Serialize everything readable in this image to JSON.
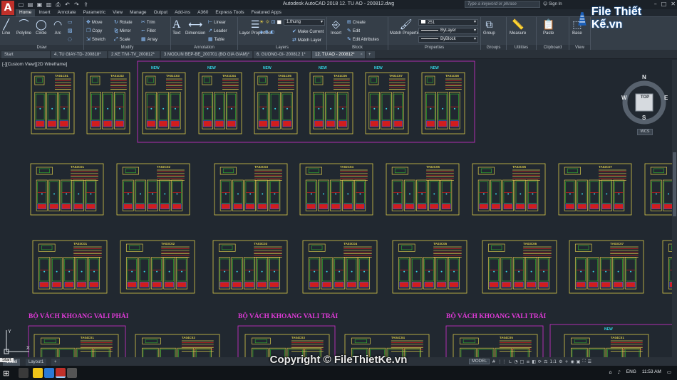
{
  "app": {
    "logo": "A",
    "title": "Autodesk AutoCAD 2018    12. TU AO - 200812.dwg",
    "search_placeholder": "Type a keyword or phrase",
    "signin": "Sign In"
  },
  "ribbon_tabs": [
    "Home",
    "Insert",
    "Annotate",
    "Parametric",
    "View",
    "Manage",
    "Output",
    "Add-ins",
    "A360",
    "Express Tools",
    "Featured Apps"
  ],
  "panels": {
    "draw": {
      "label": "Draw",
      "tools": [
        "Line",
        "Polyline",
        "Circle",
        "Arc"
      ]
    },
    "modify": {
      "label": "Modify",
      "tools": [
        "Move",
        "Rotate",
        "Trim",
        "Copy",
        "Mirror",
        "Fillet",
        "Stretch",
        "Scale",
        "Array"
      ]
    },
    "annotation": {
      "label": "Annotation",
      "tools": [
        "Text",
        "Dimension",
        "Linear",
        "Leader",
        "Table"
      ]
    },
    "layers": {
      "label": "Layers",
      "tools": [
        "Layer Properties",
        "Make Current",
        "Match Layer"
      ],
      "current_layer": "1.thung"
    },
    "block": {
      "label": "Block",
      "tools": [
        "Insert",
        "Create",
        "Edit",
        "Edit Attributes"
      ]
    },
    "properties": {
      "label": "Properties",
      "tools": [
        "Match Properties"
      ],
      "color": "251",
      "linetype": "ByLayer",
      "lineweight": "ByBlock"
    },
    "groups": {
      "label": "Groups",
      "tools": [
        "Group"
      ]
    },
    "utilities": {
      "label": "Utilities",
      "tools": [
        "Measure"
      ]
    },
    "clipboard": {
      "label": "Clipboard",
      "tools": [
        "Paste"
      ]
    },
    "view": {
      "label": "View",
      "tools": [
        "Base"
      ]
    }
  },
  "file_tabs": [
    "Start",
    "4. TU GIAY-TD- 200818*",
    "2.KE TIVI-TV_200812*",
    "3.MODUN BEP-BE_200701 (BO GIA GIAM)*",
    "6. GUONG-GI- 200812 1*",
    "12. TU AO - 200812*"
  ],
  "viewport": {
    "label": "[-][Custom View][2D Wireframe]"
  },
  "viewcube": {
    "n": "N",
    "s": "S",
    "e": "E",
    "w": "W",
    "top": "TOP",
    "wcs": "WCS"
  },
  "sections": {
    "new_label": "NEW",
    "vali_phai": "BỘ VÁCH KHOANG VALI PHẢI",
    "vali_trai_1": "BỘ VÁCH KHOANG VALI TRÁI",
    "vali_trai_2": "BỘ VÁCH KHOANG VALI TRÁI"
  },
  "sheet_codes": {
    "row1": [
      "TA01C01",
      "TA01C02",
      "TA01C03",
      "TA01C04",
      "TA01C05",
      "TA01C06",
      "TA01C07",
      "TA01C08"
    ],
    "row2": [
      "TA02C01",
      "TA02C02",
      "TA02C03",
      "TA02C04",
      "TA02C05",
      "TA02C06",
      "TA02C07",
      "TA02C08"
    ],
    "row3": [
      "TA03C01",
      "TA03C02",
      "TA03C03",
      "TA03C04",
      "TA03C05",
      "TA03C06",
      "TA03C07",
      "TA03C08"
    ],
    "row4": [
      "TA04C01",
      "TA04C02",
      "TA04C03",
      "TA04C04",
      "TA04C05"
    ]
  },
  "layout_tabs": [
    "Model",
    "Layout1",
    "+"
  ],
  "status": {
    "model": "MODEL",
    "scale": "1:1"
  },
  "taskbar": {
    "time": "11:53 AM",
    "lang": "ENG",
    "start_tooltip": "Start"
  },
  "watermark": "Copyright © FileThietKe.vn",
  "brand": "File Thiết Kế.vn",
  "colors": {
    "magenta": "#c02fc0",
    "yellow": "#d8c84a",
    "red": "#d11d1d",
    "green": "#2fb82f",
    "cyan": "#33d6e6"
  }
}
